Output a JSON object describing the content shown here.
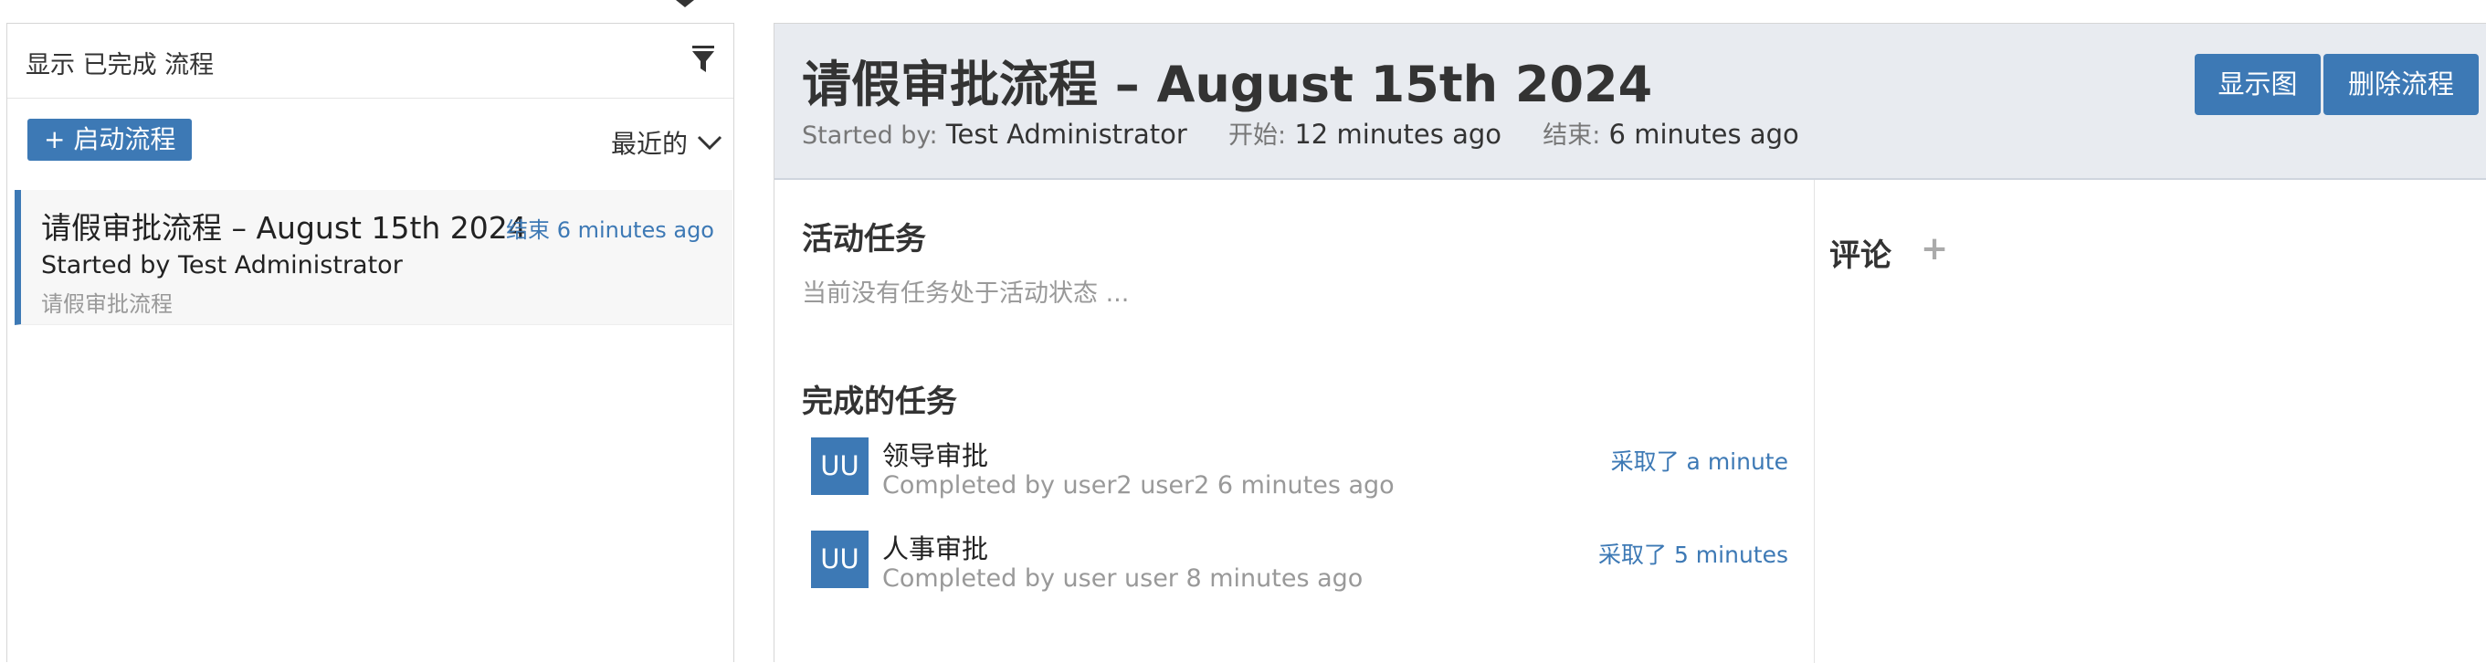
{
  "left": {
    "filter_text": "显示 已完成 流程",
    "start_button": "+ 启动流程",
    "sort_label": "最近的",
    "process": {
      "title": "请假审批流程 – August 15th 2024",
      "end": "结束 6 minutes ago",
      "started_by": "Started by Test Administrator",
      "definition": "请假审批流程"
    }
  },
  "detail": {
    "title": "请假审批流程 – August 15th 2024",
    "started_by_label": "Started by:",
    "started_by_value": "Test Administrator",
    "start_label": "开始:",
    "start_value": "12 minutes ago",
    "end_label": "结束:",
    "end_value": "6 minutes ago",
    "buttons": {
      "diagram": "显示图",
      "delete": "删除流程"
    },
    "active_tasks": {
      "title": "活动任务",
      "empty": "当前没有任务处于活动状态 ..."
    },
    "completed_tasks": {
      "title": "完成的任务",
      "items": [
        {
          "avatar": "UU",
          "name": "领导审批",
          "sub": "Completed by user2 user2 6 minutes ago",
          "duration": "采取了 a minute"
        },
        {
          "avatar": "UU",
          "name": "人事审批",
          "sub": "Completed by user user 8 minutes ago",
          "duration": "采取了 5 minutes"
        }
      ]
    },
    "comments": {
      "title": "评论",
      "add": "+"
    }
  },
  "colors": {
    "accent": "#3d79b5",
    "header_bg": "#e8ebf0",
    "muted": "#999999"
  },
  "icons": {
    "filter": "filter-icon",
    "sort": "chevron-down-icon",
    "add_comment": "plus-icon"
  }
}
